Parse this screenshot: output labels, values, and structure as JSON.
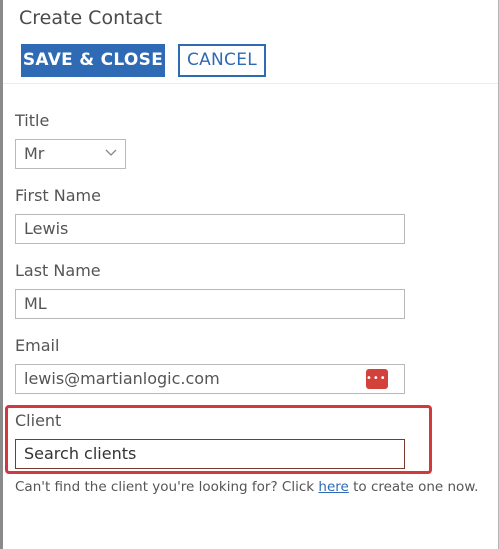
{
  "dialog": {
    "title": "Create Contact"
  },
  "toolbar": {
    "save_label": "SAVE & CLOSE",
    "cancel_label": "CANCEL"
  },
  "form": {
    "title": {
      "label": "Title",
      "value": "Mr"
    },
    "first_name": {
      "label": "First Name",
      "value": "Lewis"
    },
    "last_name": {
      "label": "Last Name",
      "value": "ML"
    },
    "email": {
      "label": "Email",
      "value": "lewis@martianlogic.com",
      "icon": "password-manager-icon"
    },
    "client": {
      "label": "Client",
      "placeholder": "Search clients",
      "help_prefix": "Can't find the client you're looking for? Click ",
      "help_link": "here",
      "help_suffix": " to create one now."
    }
  },
  "colors": {
    "primary": "#2f6ab5",
    "highlight": "#d0393d",
    "password_icon": "#d2423b"
  }
}
